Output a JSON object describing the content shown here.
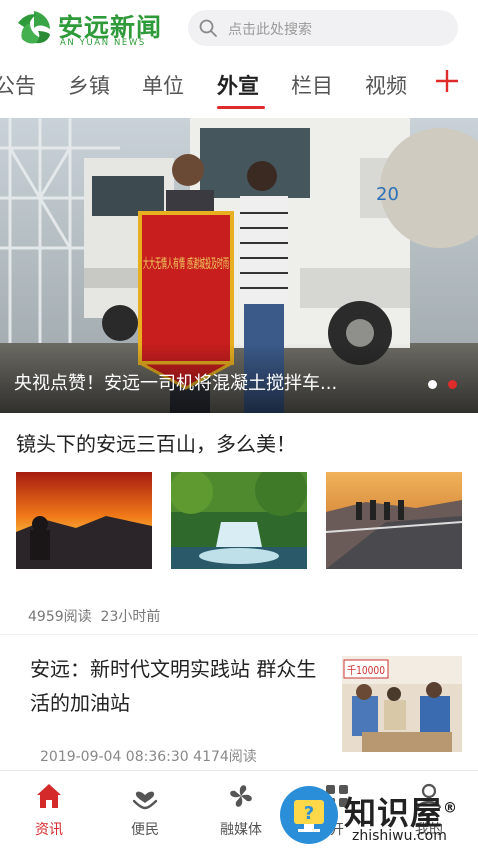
{
  "header": {
    "logo_cn": "安远新闻",
    "logo_en": "AN YUAN NEWS",
    "search_placeholder": "点击此处搜索"
  },
  "tabs": [
    {
      "label": "公告",
      "active": false
    },
    {
      "label": "乡镇",
      "active": false
    },
    {
      "label": "单位",
      "active": false
    },
    {
      "label": "外宣",
      "active": true
    },
    {
      "label": "栏目",
      "active": false
    },
    {
      "label": "视频",
      "active": false
    }
  ],
  "banner": {
    "caption": "央视点赞！安远一司机将混凝土搅拌车...",
    "banner_text": "大大无情人有情 感谢城投及时雨",
    "truck_number": "20",
    "dots": 2,
    "active_dot": 2
  },
  "gallery": {
    "title": "镜头下的安远三百山，多么美！",
    "thumbs": [
      "sunset-thumb",
      "waterfall-thumb",
      "viewpoint-thumb"
    ],
    "reads": "4959阅读",
    "time": "23小时前"
  },
  "news": {
    "title": "安远：新时代文明实践站 群众生活的加油站",
    "date": "2019-09-04 08:36:30",
    "reads": "4174阅读",
    "image_sign": "千10000"
  },
  "bottom_nav": [
    {
      "label": "资讯",
      "icon": "home-icon",
      "active": true
    },
    {
      "label": "便民",
      "icon": "heart-hand-icon",
      "active": false
    },
    {
      "label": "融媒体",
      "icon": "media-icon",
      "active": false
    },
    {
      "label": "开",
      "icon": "grid-icon",
      "active": false
    },
    {
      "label": "我的",
      "icon": "user-icon",
      "active": false
    }
  ],
  "watermark": {
    "text": "知识屋",
    "registered": "®",
    "url": "zhishiwu.com"
  },
  "colors": {
    "brand_green": "#2f9a3a",
    "accent_red": "#e02b2b",
    "watermark_blue": "#2a8fd8"
  }
}
